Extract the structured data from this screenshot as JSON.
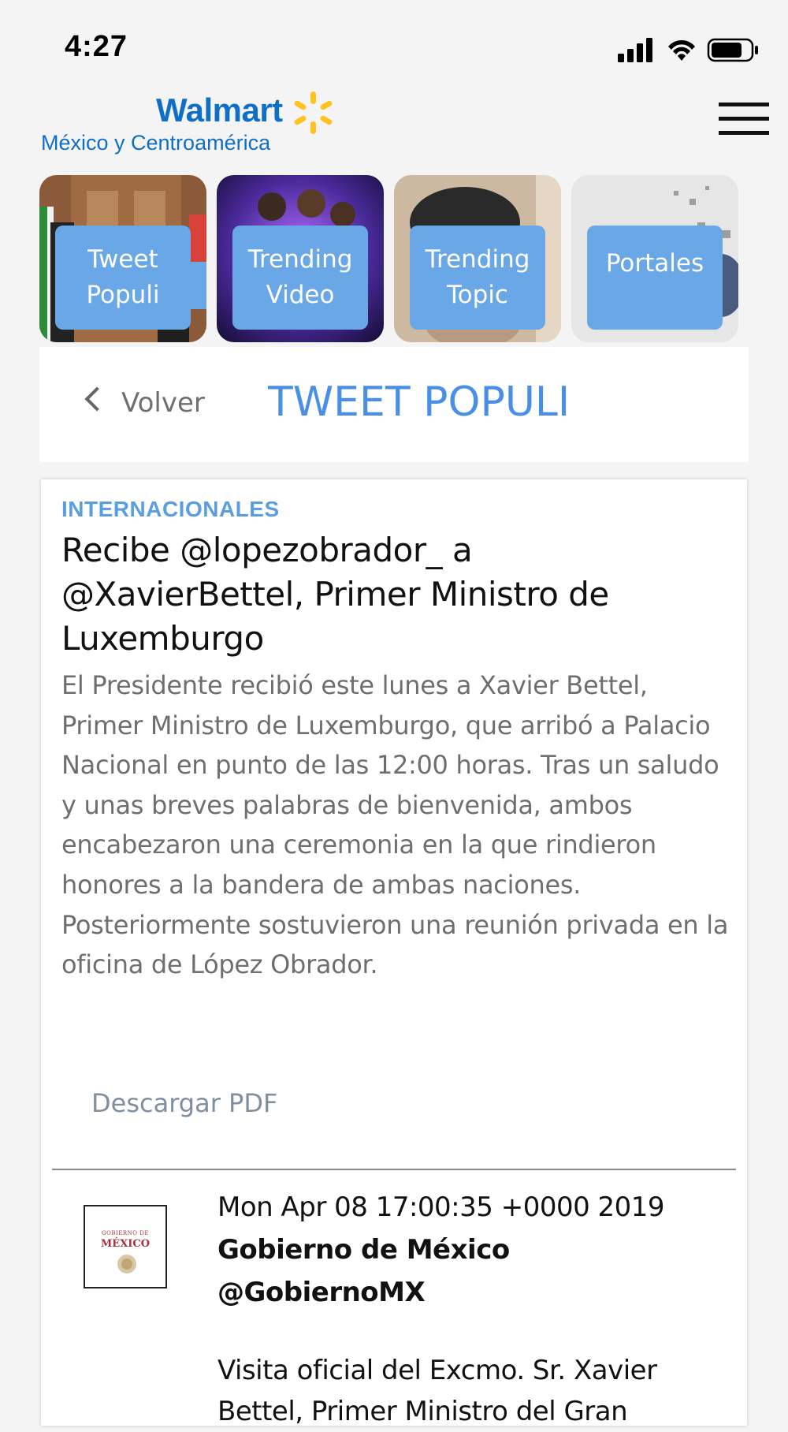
{
  "status_bar": {
    "time": "4:27",
    "icons": [
      "cellular-signal-icon",
      "wifi-icon",
      "battery-icon"
    ]
  },
  "header": {
    "logo_brand": "Walmart",
    "logo_subtitle": "México y Centroamérica",
    "menu_icon": "hamburger-menu-icon",
    "brand_color": "#0f6fc6",
    "spark_color": "#ffc220"
  },
  "tiles": [
    {
      "label": "Tweet\nPopuli"
    },
    {
      "label": "Trending\nVideo"
    },
    {
      "label": "Trending\nTopic"
    },
    {
      "label": "Portales"
    }
  ],
  "nav": {
    "back_label": "Volver",
    "title": "TWEET POPULI",
    "title_color": "#4a8fe6"
  },
  "article": {
    "category": "INTERNACIONALES",
    "headline": "Recibe @lopezobrador_ a @XavierBettel, Primer Ministro de Luxemburgo",
    "summary": "El Presidente recibió este lunes a Xavier Bettel, Primer Ministro de Luxemburgo, que arribó a Palacio Nacional en punto de las 12:00 horas. Tras un saludo y unas breves palabras de bienvenida, ambos encabezaron una ceremonia en la que rindieron honores a la bandera de ambas naciones. Posteriormente sostuvieron una reunión privada en la oficina de López Obrador.",
    "download_label": "Descargar PDF"
  },
  "tweet": {
    "date": "Mon Apr 08 17:00:35 +0000 2019",
    "author_name": "Gobierno de México",
    "author_handle": "@GobiernoMX",
    "avatar_logo_line1": "GOBIERNO DE",
    "avatar_logo_line2": "MÉXICO",
    "text": "Visita oficial del Excmo. Sr. Xavier Bettel, Primer Ministro del Gran"
  }
}
